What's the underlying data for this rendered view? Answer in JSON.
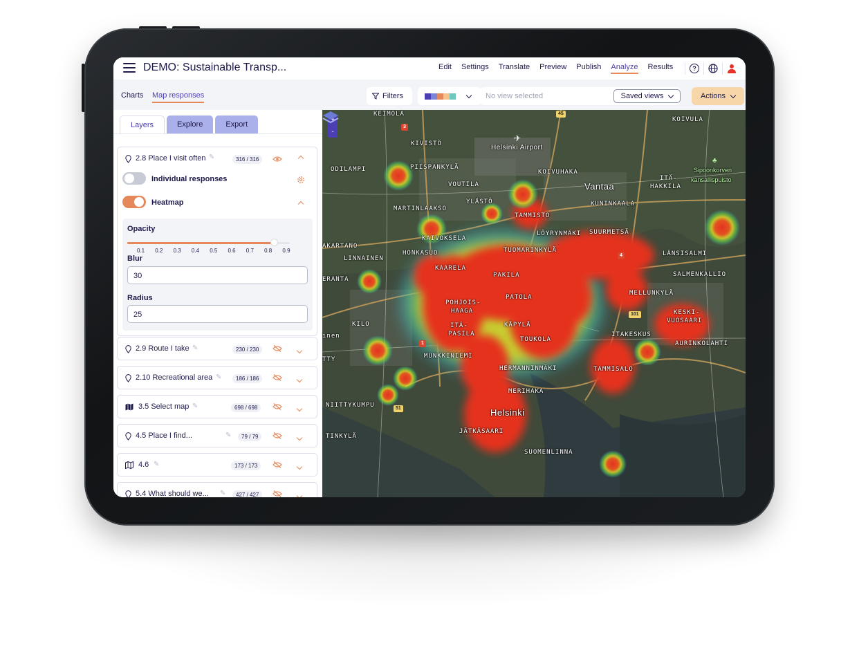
{
  "app": {
    "title": "DEMO: Sustainable Transp...",
    "nav": [
      "Edit",
      "Settings",
      "Translate",
      "Preview",
      "Publish",
      "Analyze",
      "Results"
    ],
    "active_nav": "Analyze",
    "icons": [
      "help-icon",
      "globe-icon",
      "user-icon"
    ]
  },
  "subbar": {
    "tabs": [
      "Charts",
      "Map responses"
    ],
    "active_tab": "Map responses",
    "filters_label": "Filters",
    "palette_colors": [
      "#4c3fb4",
      "#7b86d8",
      "#e5885a",
      "#f5c28a",
      "#6ec7bf"
    ],
    "view_placeholder": "No view selected",
    "saved_views_label": "Saved views",
    "actions_label": "Actions"
  },
  "panel": {
    "tabs": [
      "Layers",
      "Explore",
      "Export"
    ],
    "active_tab": "Layers",
    "expanded_layer": {
      "title": "2.8 Place I visit often",
      "count": "316 / 316",
      "individual_label": "Individual responses",
      "individual_on": false,
      "heatmap_label": "Heatmap",
      "heatmap_on": true,
      "opacity_label": "Opacity",
      "opacity_ticks": [
        "0.1",
        "0.2",
        "0.3",
        "0.4",
        "0.5",
        "0.6",
        "0.7",
        "0.8",
        "0.9"
      ],
      "opacity_value": 0.8,
      "blur_label": "Blur",
      "blur_value": "30",
      "radius_label": "Radius",
      "radius_value": "25"
    },
    "layers": [
      {
        "icon": "pin-icon",
        "title": "2.9 Route I take",
        "count": "230 / 230"
      },
      {
        "icon": "pin-icon",
        "title": "2.10 Recreational area",
        "count": "186 / 186"
      },
      {
        "icon": "map-filled-icon",
        "title": "3.5 Select map",
        "count": "698 / 698"
      },
      {
        "icon": "pin-icon",
        "title": "4.5 Place I find...",
        "count": "79 / 79"
      },
      {
        "icon": "map-outline-icon",
        "title": "4.6",
        "count": "173 / 173"
      },
      {
        "icon": "pin-icon",
        "title": "5.4 What should we...",
        "count": "427 / 427"
      }
    ]
  },
  "map": {
    "zoom_in": "+",
    "zoom_out": "-",
    "labels": [
      "KEIMOLA",
      "KIVISTÖ",
      "Helsinki Airport",
      "KOIVULA",
      "ODILAMPI",
      "PIISPANKYLÄ",
      "KOIVUHAKA",
      "Vantaa",
      "VOUTILA",
      "ITÄ-",
      "HAKKILA",
      "Sipoonkorven",
      "kansallispuisto",
      "YLÄSTÖ",
      "KUNINKAALA",
      "MARTINLAAKSO",
      "TAMMISTO",
      "KAIVOKSELA",
      "LÖYRYNMÄKI",
      "SUURMETSÄ",
      "AKARTANO",
      "HONKASUO",
      "TUOMARINKYLÄ",
      "LINNAINEN",
      "LÄNSISALMI",
      "KAARELA",
      "PAKILA",
      "SALMENKALLIO",
      "ERANTA",
      "POHJOIS-",
      "HAAGA",
      "PATOLA",
      "MELLUNKYLÄ",
      "KILO",
      "KÄPYLÄ",
      "KESKI-",
      "VUOSAARI",
      "ITÄ-",
      "PASILA",
      "TOUKOLA",
      "ITAKESKUS",
      "inen",
      "AURINKOLAHTI",
      "MUNKKINIEMI",
      "TTY",
      "HERMANNINMÄKI",
      "TAMMISALO",
      "MERIHAKA",
      "NIITTYKUMPU",
      "Helsinki",
      "JÄTKÄSAARI",
      "TINKYLÄ",
      "SUOMENLINNA"
    ],
    "road_numbers": [
      "45",
      "3",
      "1",
      "101",
      "51",
      "4"
    ]
  }
}
